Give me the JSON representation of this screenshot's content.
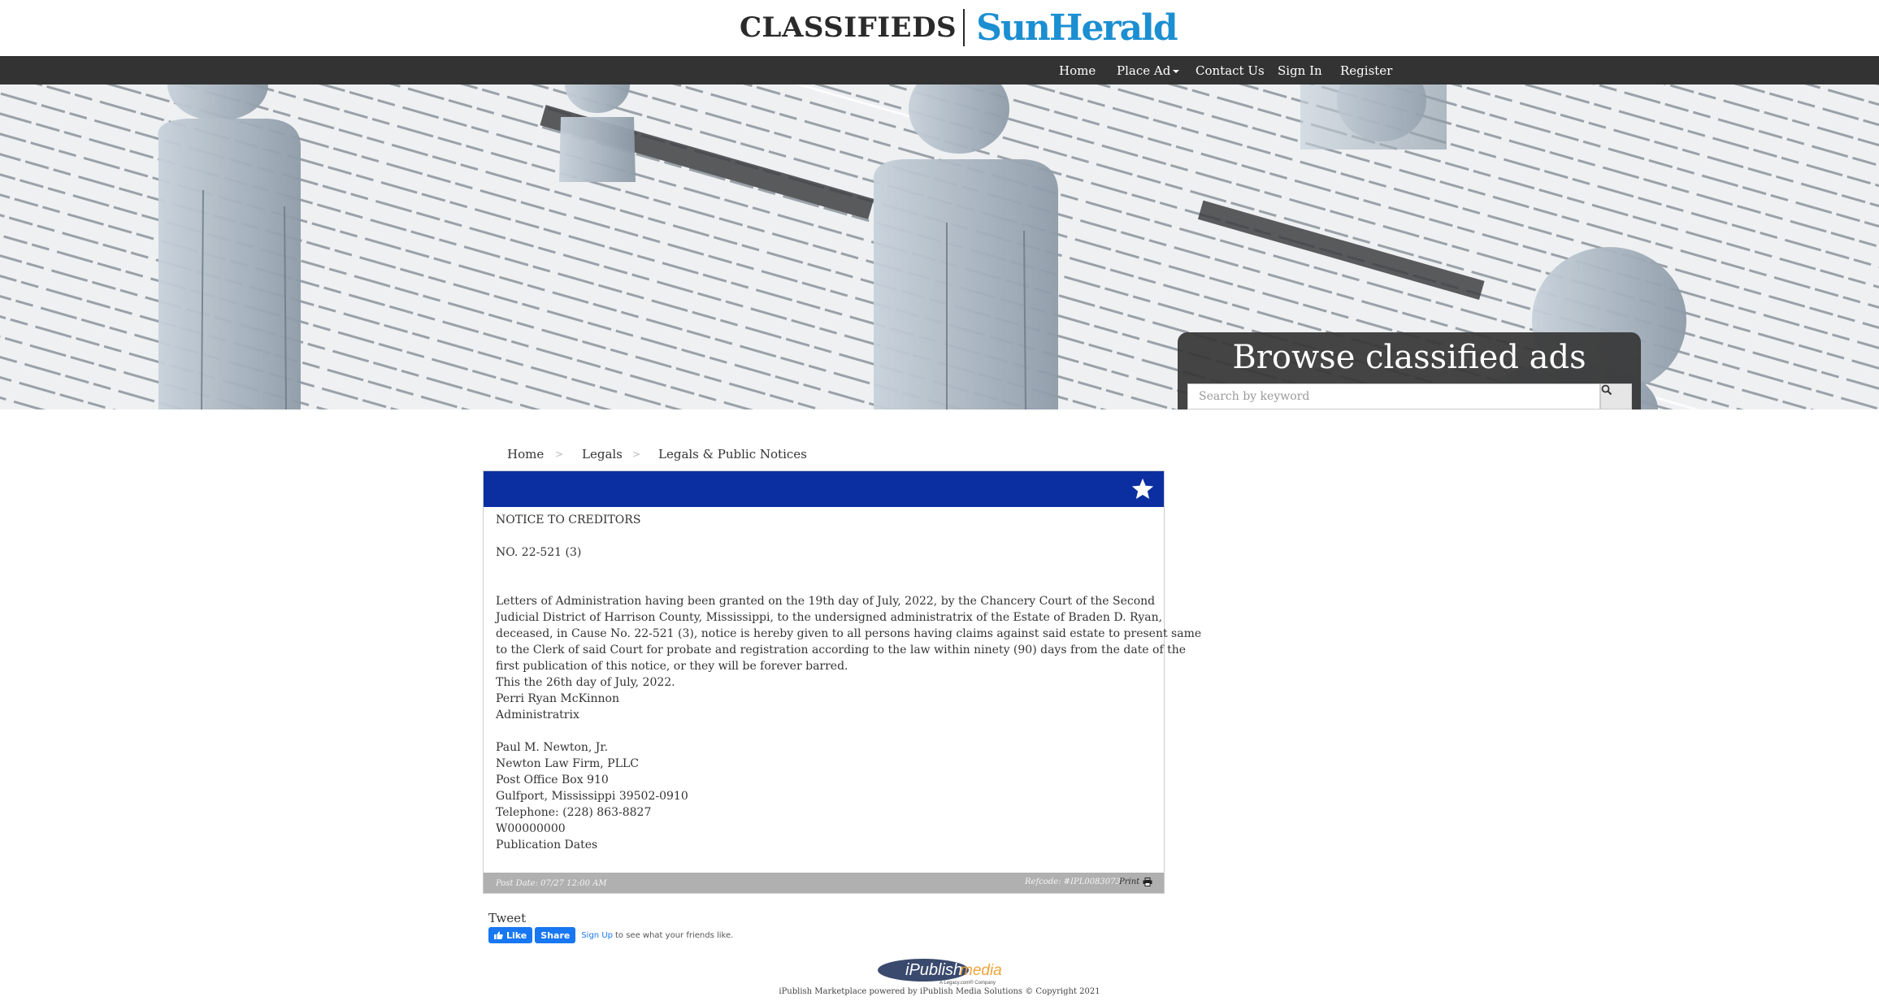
{
  "header": {
    "brand_left": "CLASSIFIEDS",
    "brand_right": "SunHerald",
    "brand_right_color": "#1b8fd1"
  },
  "nav": {
    "items": [
      {
        "label": "Home"
      },
      {
        "label": "Place Ad"
      },
      {
        "label": "Contact Us"
      },
      {
        "label": "Sign In"
      },
      {
        "label": "Register"
      }
    ],
    "background": "#333333"
  },
  "hero": {
    "title": "Browse classified ads",
    "search_placeholder": "Search by keyword",
    "search_icon": "search-icon"
  },
  "breadcrumb": {
    "items": [
      "Home",
      "Legals",
      "Legals & Public Notices"
    ],
    "separator": ">"
  },
  "ad": {
    "header_color": "#0b2fa0",
    "star_icon": "star-icon",
    "title": "NOTICE TO CREDITORS",
    "number": "NO. 22-521 (3)",
    "body_lines": [
      "Letters of Administration having been granted on the 19th day of July, 2022, by the Chancery Court of the Second",
      "Judicial District of Harrison County, Mississippi, to the undersigned administratrix of the Estate of Braden D. Ryan,",
      "deceased, in Cause No. 22-521 (3), notice is hereby given to all persons having claims against said estate to present same",
      "to the Clerk of said Court for probate and registration according to the law within ninety (90) days from the date of the",
      "first publication of this notice, or they will be forever barred.",
      "This the 26th day of July, 2022.",
      "Perri Ryan McKinnon",
      "Administratrix"
    ],
    "contact_lines": [
      "Paul M. Newton, Jr.",
      "Newton Law Firm, PLLC",
      "Post Office Box 910",
      "Gulfport, Mississippi 39502-0910",
      "Telephone: (228) 863-8827",
      "W00000000",
      "Publication Dates"
    ],
    "post_date": "Post Date: 07/27 12:00 AM",
    "refcode": "Refcode: #IPL0083073",
    "print_label": "Print",
    "print_icon": "printer-icon"
  },
  "social": {
    "tweet": "Tweet",
    "fb_like": "Like",
    "fb_share": "Share",
    "fb_signup": "Sign Up",
    "fb_text": "to see what your friends like."
  },
  "footer": {
    "logo_main": "iPublish",
    "logo_accent": "media",
    "logo_tagline": "A Legacy.com® Company",
    "copyright": "iPublish Marketplace powered by iPublish Media Solutions © Copyright 2021"
  }
}
